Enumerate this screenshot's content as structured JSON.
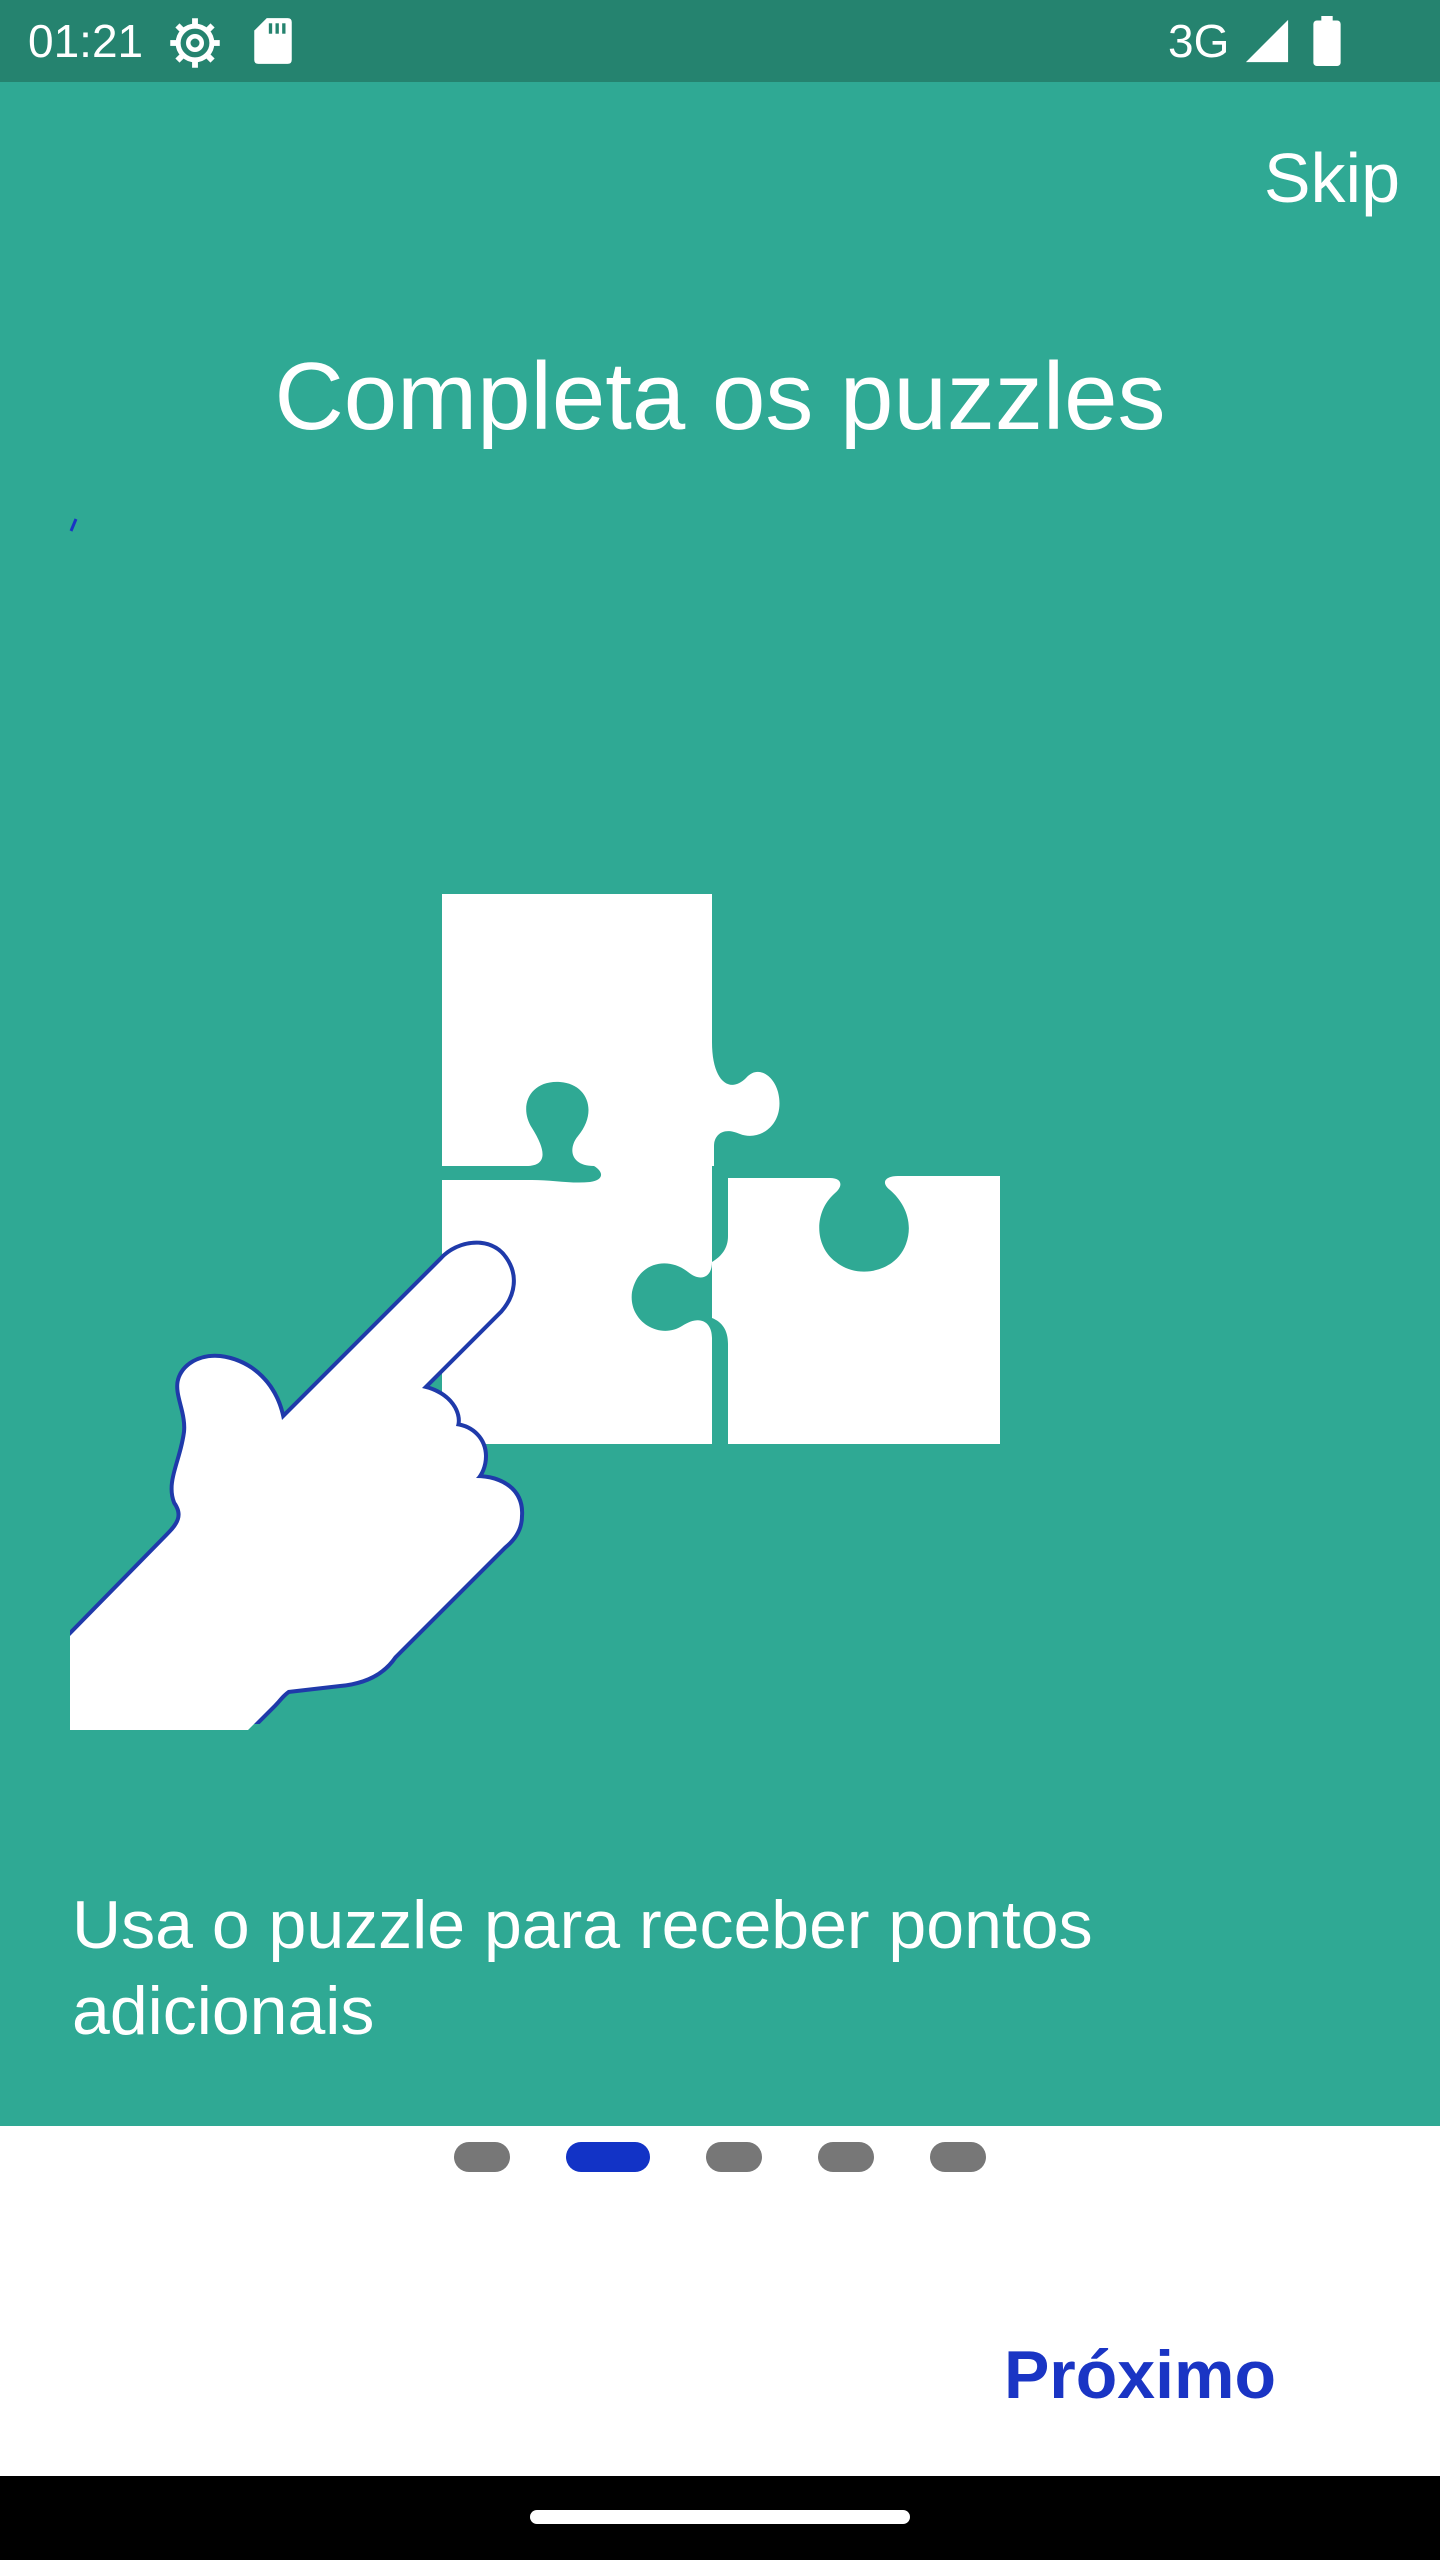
{
  "status_bar": {
    "time": "01:21",
    "network": "3G",
    "icons": [
      "settings-gear-icon",
      "sd-card-icon",
      "signal-icon",
      "battery-icon"
    ]
  },
  "onboarding": {
    "skip_label": "Skip",
    "title": "Completa os puzzles",
    "illustration": "puzzle-hand-icon",
    "description": "Usa o puzzle para receber pontos adicionais",
    "page_count": 5,
    "active_page": 2,
    "next_label": "Próximo"
  },
  "colors": {
    "hero_background": "#2fa994",
    "status_bar": "#25836f",
    "accent": "#1a35c4",
    "inactive_dot": "#777777"
  }
}
